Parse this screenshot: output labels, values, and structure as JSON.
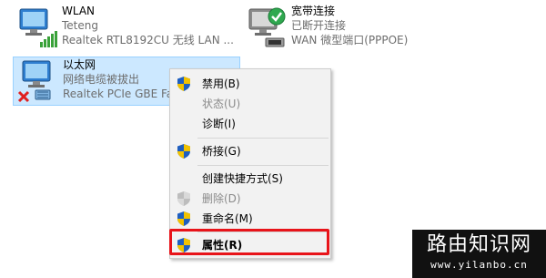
{
  "adapters": {
    "wlan": {
      "name": "WLAN",
      "status": "Teteng",
      "device": "Realtek RTL8192CU 无线 LAN ..."
    },
    "broadband": {
      "name": "宽带连接",
      "status": "已断开连接",
      "device": "WAN 微型端口(PPPOE)"
    },
    "ethernet": {
      "name": "以太网",
      "status": "网络电缆被拔出",
      "device": "Realtek PCIe GBE Fa"
    }
  },
  "context_menu": {
    "disable": "禁用(B)",
    "status": "状态(U)",
    "diagnose": "诊断(I)",
    "bridge": "桥接(G)",
    "create_shortcut": "创建快捷方式(S)",
    "delete": "删除(D)",
    "rename": "重命名(M)",
    "properties": "属性(R)"
  },
  "watermark": {
    "title": "路由知识网",
    "url": "www.yilanbo.cn"
  },
  "colors": {
    "highlight": "#e8141a",
    "selection": "#cce8ff",
    "shield_blue": "#1f5fbf",
    "shield_yellow": "#f2c200"
  }
}
